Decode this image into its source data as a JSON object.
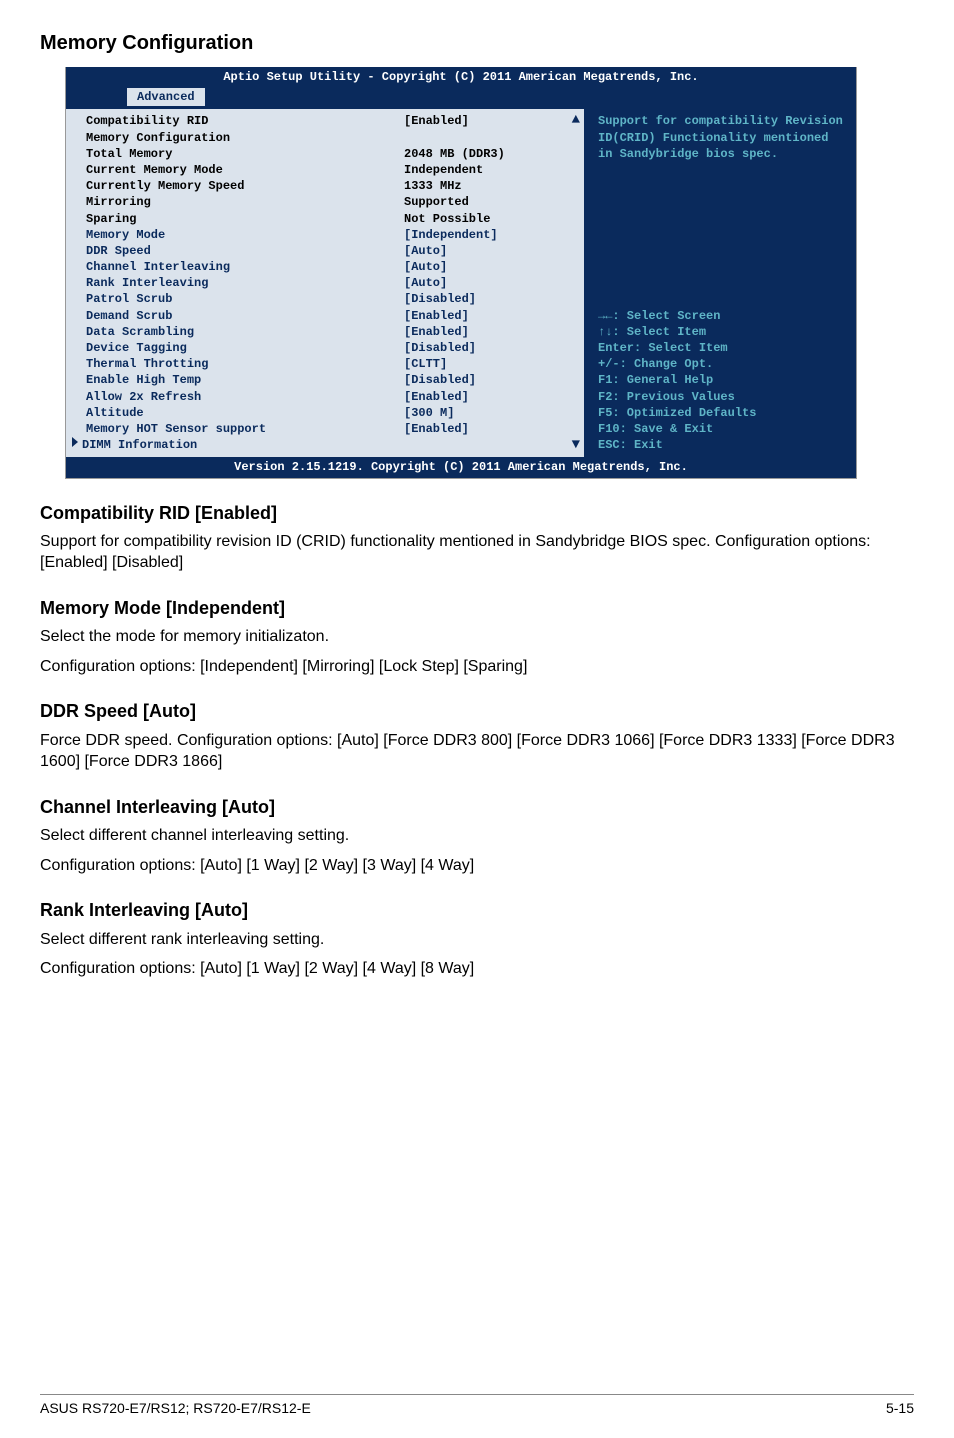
{
  "headings": {
    "mem_cfg": "Memory Configuration",
    "compat_rid": "Compatibility RID [Enabled]",
    "mem_mode": "Memory Mode [Independent]",
    "ddr_speed": "DDR Speed [Auto]",
    "chan_int": "Channel Interleaving [Auto]",
    "rank_int": "Rank Interleaving [Auto]"
  },
  "paras": {
    "compat_rid": "Support for compatibility revision ID (CRID) functionality mentioned in Sandybridge BIOS spec. Configuration options: [Enabled] [Disabled]",
    "mem_mode_1": "Select the mode for memory initializaton.",
    "mem_mode_2": "Configuration options: [Independent] [Mirroring] [Lock Step] [Sparing]",
    "ddr_speed": "Force DDR speed. Configuration options: [Auto] [Force DDR3 800] [Force DDR3 1066] [Force DDR3 1333] [Force DDR3 1600] [Force DDR3 1866]",
    "chan_int_1": "Select different channel interleaving setting.",
    "chan_int_2": "Configuration options: [Auto] [1 Way] [2 Way] [3 Way] [4 Way]",
    "rank_int_1": "Select different rank interleaving setting.",
    "rank_int_2": "Configuration options: [Auto] [1 Way] [2 Way] [4 Way] [8 Way]"
  },
  "bios": {
    "title": "Aptio Setup Utility - Copyright (C) 2011 American Megatrends, Inc.",
    "tab": "Advanced",
    "footer": "Version 2.15.1219. Copyright (C) 2011 American Megatrends, Inc.",
    "help_text": "Support for compatibility Revision ID(CRID) Functionality mentioned in Sandybridge bios spec.",
    "help_keys": {
      "sel_screen": "→←: Select Screen",
      "sel_item": "↑↓:  Select Item",
      "enter": "Enter: Select Item",
      "change": "+/-: Change Opt.",
      "f1": "F1: General Help",
      "f2": "F2: Previous Values",
      "f5": "F5: Optimized Defaults",
      "f10": "F10: Save & Exit",
      "esc": "ESC: Exit"
    },
    "rows": [
      {
        "label": "Compatibility RID",
        "value": "[Enabled]",
        "lc": "black",
        "vc": "black"
      },
      {
        "label": "",
        "value": "",
        "lc": "black",
        "vc": "black"
      },
      {
        "label": "Memory Configuration",
        "value": "",
        "lc": "black",
        "vc": "black"
      },
      {
        "label": "",
        "value": "",
        "lc": "black",
        "vc": "black"
      },
      {
        "label": "Total Memory",
        "value": "2048 MB (DDR3)",
        "lc": "black",
        "vc": "black"
      },
      {
        "label": "Current Memory Mode",
        "value": "Independent",
        "lc": "black",
        "vc": "black"
      },
      {
        "label": "Currently Memory Speed",
        "value": "1333 MHz",
        "lc": "black",
        "vc": "black"
      },
      {
        "label": "Mirroring",
        "value": "Supported",
        "lc": "black",
        "vc": "black"
      },
      {
        "label": "Sparing",
        "value": "Not Possible",
        "lc": "black",
        "vc": "black"
      },
      {
        "label": "Memory Mode",
        "value": "[Independent]",
        "lc": "blue",
        "vc": "blue"
      },
      {
        "label": "DDR Speed",
        "value": "[Auto]",
        "lc": "blue",
        "vc": "blue"
      },
      {
        "label": "Channel Interleaving",
        "value": "[Auto]",
        "lc": "blue",
        "vc": "blue"
      },
      {
        "label": "Rank Interleaving",
        "value": "[Auto]",
        "lc": "blue",
        "vc": "blue"
      },
      {
        "label": "Patrol Scrub",
        "value": "[Disabled]",
        "lc": "blue",
        "vc": "blue"
      },
      {
        "label": "Demand Scrub",
        "value": "[Enabled]",
        "lc": "blue",
        "vc": "blue"
      },
      {
        "label": "Data Scrambling",
        "value": "[Enabled]",
        "lc": "blue",
        "vc": "blue"
      },
      {
        "label": "Device Tagging",
        "value": "[Disabled]",
        "lc": "blue",
        "vc": "blue"
      },
      {
        "label": "Thermal Throtting",
        "value": "[CLTT]",
        "lc": "blue",
        "vc": "blue"
      },
      {
        "label": "Enable High Temp",
        "value": "[Disabled]",
        "lc": "blue",
        "vc": "blue"
      },
      {
        "label": "Allow 2x Refresh",
        "value": "[Enabled]",
        "lc": "blue",
        "vc": "blue"
      },
      {
        "label": "Altitude",
        "value": "[300 M]",
        "lc": "blue",
        "vc": "blue"
      },
      {
        "label": "Memory HOT Sensor support",
        "value": "[Enabled]",
        "lc": "blue",
        "vc": "blue"
      }
    ],
    "submenu": {
      "label": "DIMM Information"
    }
  },
  "arrows": {
    "up": "▲",
    "down": "▼"
  },
  "footer_page": {
    "left": "ASUS RS720-E7/RS12; RS720-E7/RS12-E",
    "right": "5-15"
  }
}
